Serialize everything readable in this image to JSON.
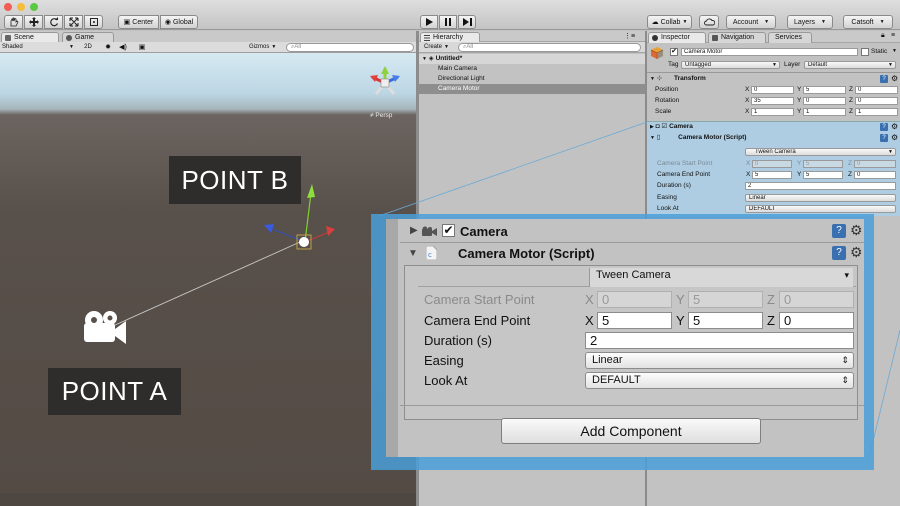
{
  "toolbar": {
    "pivot_label": "Center",
    "global_label": "Global",
    "collab_label": "Collab",
    "account_label": "Account",
    "layers_label": "Layers",
    "layout_label": "Catsoft"
  },
  "scene_tabs": {
    "scene": "Scene",
    "game": "Game"
  },
  "scene_bar": {
    "shading": "Shaded",
    "mode_2d": "2D",
    "gizmos": "Gizmos",
    "search_placeholder": "All"
  },
  "scene": {
    "persp_label": "Persp",
    "point_b": "POINT B",
    "point_a": "POINT A"
  },
  "hierarchy": {
    "tab": "Hierarchy",
    "create_label": "Create",
    "search_placeholder": "All",
    "scene_name": "Untitled*",
    "items": [
      "Main Camera",
      "Directional Light",
      "Camera Motor"
    ]
  },
  "inspector": {
    "tabs": [
      "Inspector",
      "Navigation",
      "Services"
    ],
    "object_name": "Camera Motor",
    "static_label": "Static",
    "tag_label": "Tag",
    "tag_value": "Untagged",
    "layer_label": "Layer",
    "layer_value": "Default",
    "transform": {
      "title": "Transform",
      "rows": [
        {
          "label": "Position",
          "x": "0",
          "y": "5",
          "z": "0"
        },
        {
          "label": "Rotation",
          "x": "35",
          "y": "0",
          "z": "0"
        },
        {
          "label": "Scale",
          "x": "1",
          "y": "1",
          "z": "1"
        }
      ]
    },
    "camera_title": "Camera",
    "motor_title": "Camera Motor (Script)",
    "script_dropdown": "Tween Camera",
    "fields": {
      "start_label": "Camera Start Point",
      "start": {
        "x": "0",
        "y": "5",
        "z": "0"
      },
      "end_label": "Camera End Point",
      "end": {
        "x": "5",
        "y": "5",
        "z": "0"
      },
      "duration_label": "Duration (s)",
      "duration": "2",
      "easing_label": "Easing",
      "easing": "Linear",
      "lookat_label": "Look At",
      "lookat": "DEFAULT"
    },
    "axis": {
      "x": "X",
      "y": "Y",
      "z": "Z"
    },
    "add_component": "Add Component"
  },
  "colors": {
    "accent_blue": "#4a9fd8",
    "scene_ground": "#58504a"
  }
}
